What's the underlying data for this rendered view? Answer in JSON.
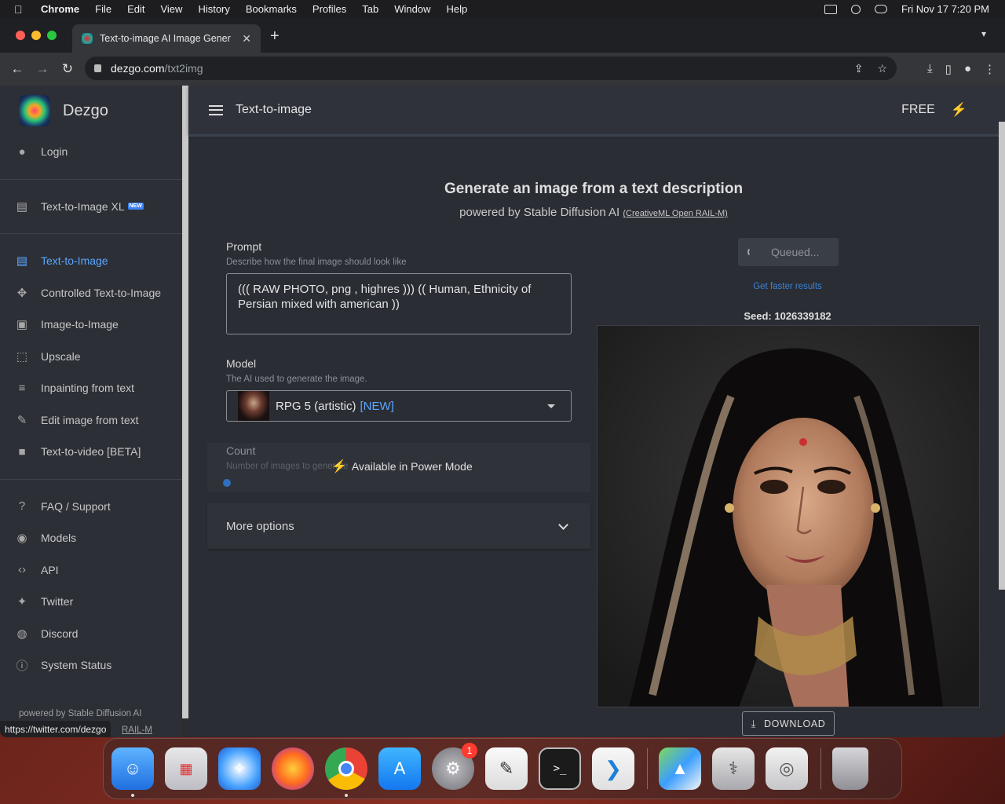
{
  "menubar": {
    "app": "Chrome",
    "items": [
      "File",
      "Edit",
      "View",
      "History",
      "Bookmarks",
      "Profiles",
      "Tab",
      "Window",
      "Help"
    ],
    "clock": "Fri Nov 17  7:20 PM"
  },
  "browser": {
    "tab_title": "Text-to-image AI Image Gener",
    "url_host": "dezgo.com",
    "url_path": "/txt2img",
    "status_url": "https://twitter.com/dezgo"
  },
  "sidebar": {
    "brand": "Dezgo",
    "login": "Login",
    "xl_item": "Text-to-Image XL",
    "xl_badge": "NEW",
    "tools": [
      {
        "label": "Text-to-Image",
        "icon": "chat-icon"
      },
      {
        "label": "Controlled Text-to-Image",
        "icon": "control-icon"
      },
      {
        "label": "Image-to-Image",
        "icon": "image-icon"
      },
      {
        "label": "Upscale",
        "icon": "upscale-icon"
      },
      {
        "label": "Inpainting from text",
        "icon": "inpaint-icon"
      },
      {
        "label": "Edit image from text",
        "icon": "edit-icon"
      },
      {
        "label": "Text-to-video [BETA]",
        "icon": "video-icon"
      }
    ],
    "links": [
      {
        "label": "FAQ / Support",
        "icon": "question-icon"
      },
      {
        "label": "Models",
        "icon": "models-icon"
      },
      {
        "label": "API",
        "icon": "code-icon"
      },
      {
        "label": "Twitter",
        "icon": "twitter-icon"
      },
      {
        "label": "Discord",
        "icon": "discord-icon"
      },
      {
        "label": "System Status",
        "icon": "info-icon"
      }
    ],
    "footer": "powered by Stable Diffusion AI",
    "footer_license": "RAIL-M"
  },
  "appbar": {
    "title": "Text-to-image",
    "plan": "FREE"
  },
  "main": {
    "heading": "Generate an image from a text description",
    "subheading": "powered by Stable Diffusion AI",
    "license": "(CreativeML Open RAIL-M)",
    "prompt_label": "Prompt",
    "prompt_help": "Describe how the final image should look like",
    "prompt_value": "((( RAW PHOTO, png , highres ))) (( Human, Ethnicity of Persian mixed with american ))",
    "model_label": "Model",
    "model_help": "The AI used to generate the image.",
    "model_value": "RPG 5 (artistic)",
    "model_tag": "[NEW]",
    "count_label": "Count",
    "count_help": "Number of images to generate",
    "power_mode": "Available in Power Mode",
    "more_options": "More options",
    "queued": "Queued...",
    "faster": "Get faster results",
    "seed": "Seed: 1026339182",
    "download": "DOWNLOAD"
  },
  "dock": {
    "apps": [
      "finder-icon",
      "launchpad-icon",
      "safari-icon",
      "firefox-icon",
      "chrome-icon",
      "app-store-icon",
      "system-settings-icon",
      "textedit-icon",
      "terminal-icon",
      "vscode-icon",
      "maps-icon",
      "disk-utility-icon",
      "preview-icon",
      "trash-icon"
    ],
    "settings_badge": "1"
  }
}
